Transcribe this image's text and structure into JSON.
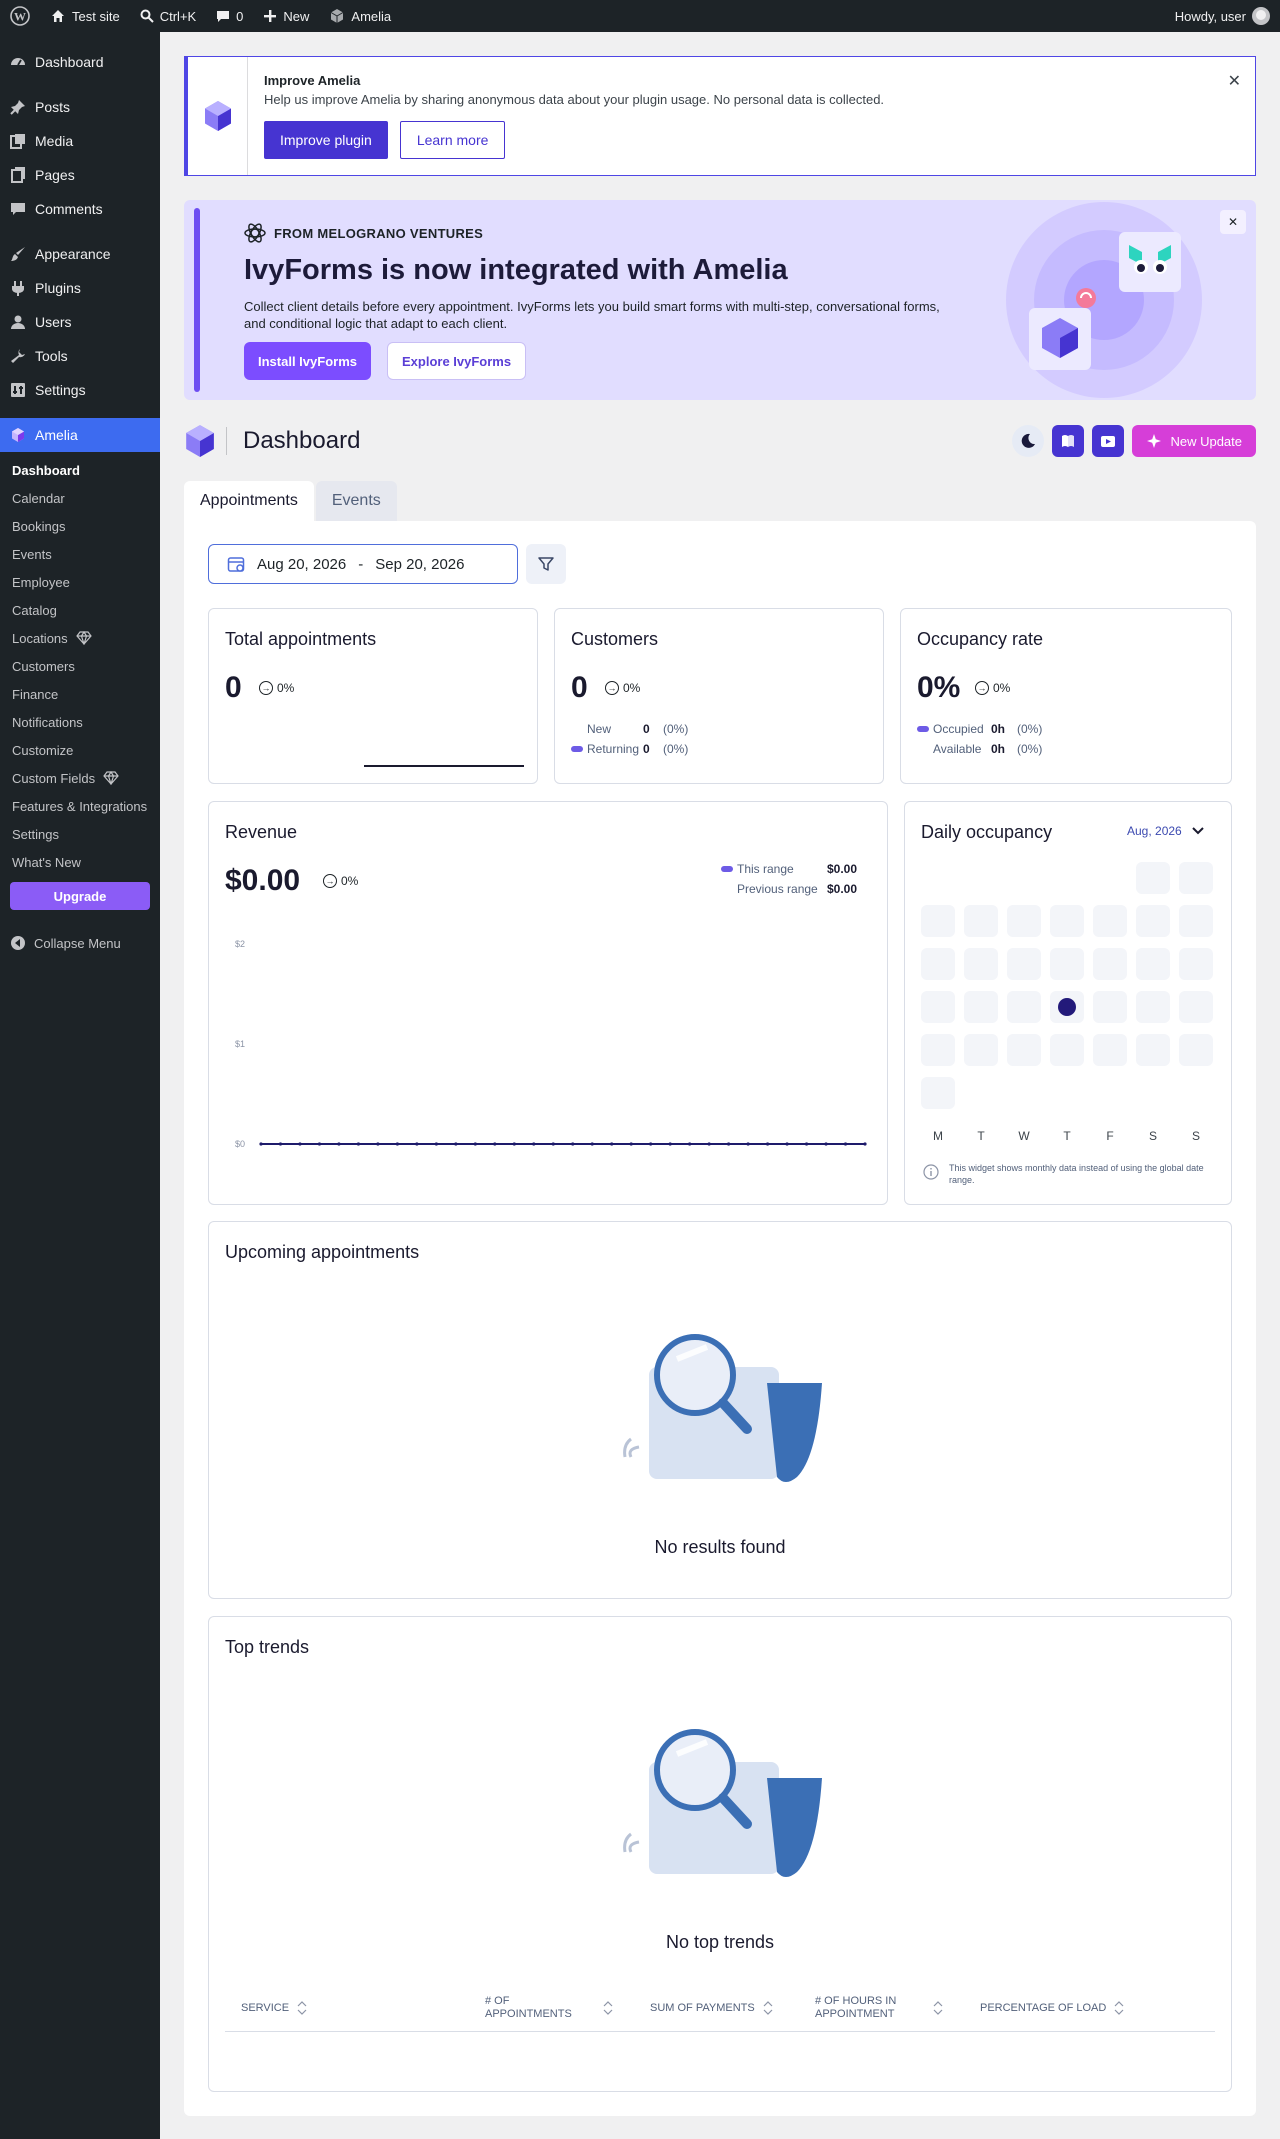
{
  "adminbar": {
    "site": "Test site",
    "search_shortcut": "Ctrl+K",
    "comments": "0",
    "new": "New",
    "plugin": "Amelia",
    "howdy": "Howdy, user"
  },
  "sidebar": {
    "items": [
      {
        "label": "Dashboard",
        "icon": "dashboard-icon"
      },
      {
        "label": "Posts",
        "icon": "pin-icon"
      },
      {
        "label": "Media",
        "icon": "media-icon"
      },
      {
        "label": "Pages",
        "icon": "pages-icon"
      },
      {
        "label": "Comments",
        "icon": "comment-icon"
      },
      {
        "label": "Appearance",
        "icon": "brush-icon"
      },
      {
        "label": "Plugins",
        "icon": "plug-icon"
      },
      {
        "label": "Users",
        "icon": "user-icon"
      },
      {
        "label": "Tools",
        "icon": "wrench-icon"
      },
      {
        "label": "Settings",
        "icon": "settings-icon"
      },
      {
        "label": "Amelia",
        "icon": "amelia-logo-icon"
      }
    ],
    "amelia_sub": [
      "Dashboard",
      "Calendar",
      "Bookings",
      "Events",
      "Employee",
      "Catalog",
      "Locations",
      "Customers",
      "Finance",
      "Notifications",
      "Customize",
      "Custom Fields",
      "Features & Integrations",
      "Settings",
      "What's New"
    ],
    "upgrade": "Upgrade",
    "collapse": "Collapse Menu"
  },
  "notice": {
    "title": "Improve Amelia",
    "text": "Help us improve Amelia by sharing anonymous data about your plugin usage. No personal data is collected.",
    "btn_primary": "Improve plugin",
    "btn_secondary": "Learn more",
    "close": "✕"
  },
  "promo": {
    "eyebrow": "FROM MELOGRANO VENTURES",
    "title": "IvyForms is now integrated with Amelia",
    "text": "Collect client details before every appointment. IvyForms lets you build smart forms with multi-step, conversational forms, and conditional logic that adapt to each client.",
    "btn_install": "Install IvyForms",
    "btn_explore": "Explore IvyForms",
    "close": "✕"
  },
  "header": {
    "title": "Dashboard",
    "new_update": "New Update"
  },
  "tabs": [
    "Appointments",
    "Events"
  ],
  "filters": {
    "date_from": "Aug 20, 2026",
    "date_sep": "-",
    "date_to": "Sep 20, 2026"
  },
  "cards": {
    "total": {
      "title": "Total appointments",
      "value": "0",
      "pct": "0%"
    },
    "customers": {
      "title": "Customers",
      "value": "0",
      "pct": "0%",
      "rows": [
        {
          "label": "New",
          "value": "0",
          "pct": "(0%)"
        },
        {
          "label": "Returning",
          "value": "0",
          "pct": "(0%)"
        }
      ]
    },
    "occupancy": {
      "title": "Occupancy rate",
      "value": "0%",
      "pct": "0%",
      "rows": [
        {
          "label": "Occupied",
          "value": "0h",
          "pct": "(0%)"
        },
        {
          "label": "Available",
          "value": "0h",
          "pct": "(0%)"
        }
      ]
    },
    "revenue": {
      "title": "Revenue",
      "value": "$0.00",
      "pct": "0%",
      "legend": [
        {
          "label": "This range",
          "value": "$0.00"
        },
        {
          "label": "Previous range",
          "value": "$0.00"
        }
      ]
    },
    "daily": {
      "title": "Daily occupancy",
      "month": "Aug, 2026",
      "days": [
        "M",
        "T",
        "W",
        "T",
        "F",
        "S",
        "S"
      ],
      "note": "This widget shows monthly data instead of using the global date range."
    }
  },
  "upcoming": {
    "title": "Upcoming appointments",
    "empty": "No results found"
  },
  "trends": {
    "title": "Top trends",
    "empty": "No top trends",
    "columns": [
      "SERVICE",
      "# OF APPOINTMENTS",
      "SUM OF PAYMENTS",
      "# OF HOURS IN APPOINTMENT",
      "PERCENTAGE OF LOAD"
    ]
  },
  "chart_data": {
    "type": "line",
    "title": "Revenue",
    "yticks": [
      "$2",
      "$1",
      "$0"
    ],
    "ylim": [
      0,
      2
    ],
    "x": [
      1,
      2,
      3,
      4,
      5,
      6,
      7,
      8,
      9,
      10,
      11,
      12,
      13,
      14,
      15,
      16,
      17,
      18,
      19,
      20,
      21,
      22,
      23,
      24,
      25,
      26,
      27,
      28,
      29,
      30,
      31,
      32
    ],
    "series": [
      {
        "name": "This range",
        "values": [
          0,
          0,
          0,
          0,
          0,
          0,
          0,
          0,
          0,
          0,
          0,
          0,
          0,
          0,
          0,
          0,
          0,
          0,
          0,
          0,
          0,
          0,
          0,
          0,
          0,
          0,
          0,
          0,
          0,
          0,
          0,
          0
        ]
      }
    ],
    "colors": {
      "line": "#1e1b6b"
    },
    "grid": false
  },
  "colors": {
    "accent": "#4634d1",
    "amelia_blue": "#3d6bf0",
    "new_update": "#d63ed8",
    "promo_bg": "#e1ddff"
  }
}
